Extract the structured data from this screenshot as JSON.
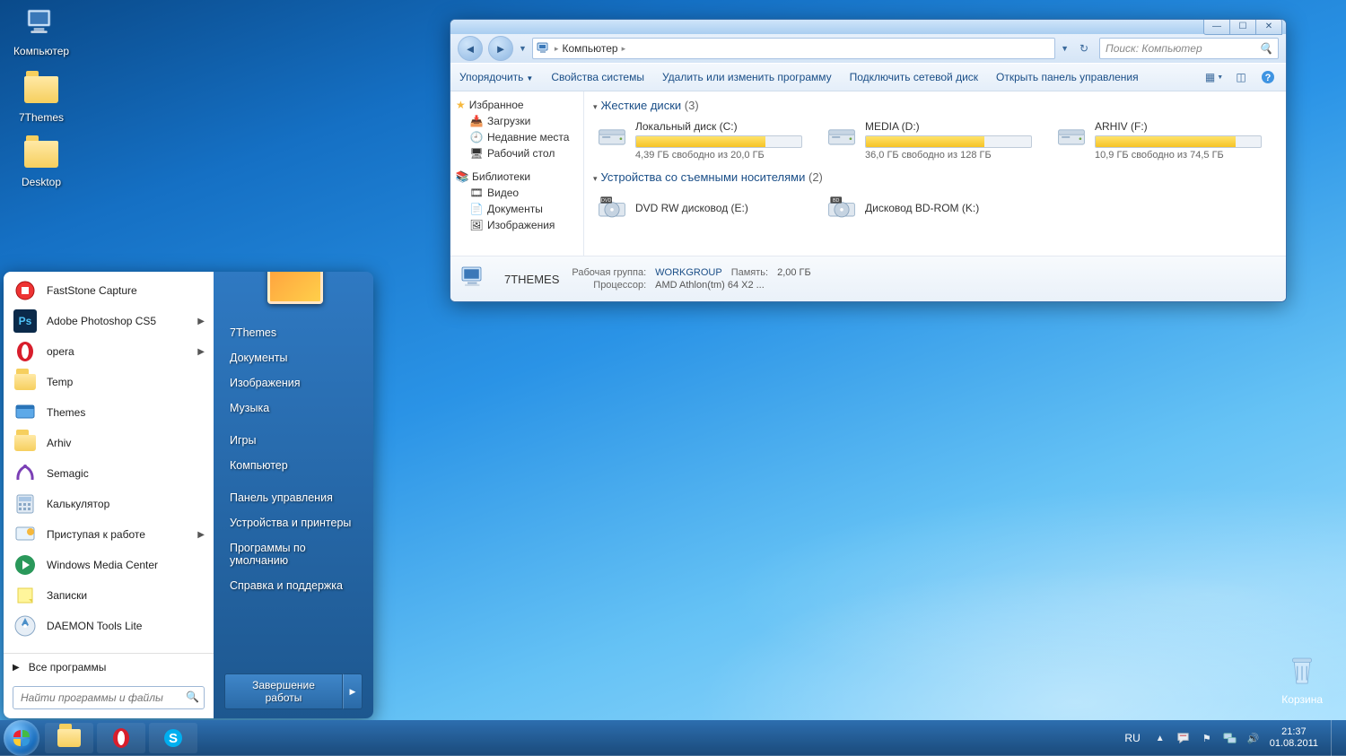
{
  "desktop": {
    "icons": [
      {
        "name": "computer",
        "label": "Компьютер"
      },
      {
        "name": "7themes",
        "label": "7Themes"
      },
      {
        "name": "desktop-folder",
        "label": "Desktop"
      }
    ],
    "recycle_label": "Корзина"
  },
  "startmenu": {
    "apps": [
      {
        "label": "FastStone Capture",
        "has_arrow": false,
        "icon_bg": "#fff",
        "icon": "fs"
      },
      {
        "label": "Adobe Photoshop CS5",
        "has_arrow": true,
        "icon_bg": "#0b2a4a",
        "icon": "ps"
      },
      {
        "label": "opera",
        "has_arrow": true,
        "icon_bg": "#fff",
        "icon": "op"
      },
      {
        "label": "Temp",
        "has_arrow": false,
        "icon_bg": "",
        "icon": "folder"
      },
      {
        "label": "Themes",
        "has_arrow": false,
        "icon_bg": "",
        "icon": "themes"
      },
      {
        "label": "Arhiv",
        "has_arrow": false,
        "icon_bg": "",
        "icon": "folder"
      },
      {
        "label": "Semagic",
        "has_arrow": false,
        "icon_bg": "#fff",
        "icon": "sem"
      },
      {
        "label": "Калькулятор",
        "has_arrow": false,
        "icon_bg": "",
        "icon": "calc"
      },
      {
        "label": "Приступая к работе",
        "has_arrow": true,
        "icon_bg": "",
        "icon": "gs"
      },
      {
        "label": "Windows Media Center",
        "has_arrow": false,
        "icon_bg": "",
        "icon": "wmc"
      },
      {
        "label": "Записки",
        "has_arrow": false,
        "icon_bg": "",
        "icon": "note"
      },
      {
        "label": "DAEMON Tools Lite",
        "has_arrow": false,
        "icon_bg": "",
        "icon": "dt"
      }
    ],
    "all_programs": "Все программы",
    "search_placeholder": "Найти программы и файлы",
    "right_links": [
      "7Themes",
      "Документы",
      "Изображения",
      "Музыка",
      "",
      "Игры",
      "Компьютер",
      "",
      "Панель управления",
      "Устройства и принтеры",
      "Программы по умолчанию",
      "Справка и поддержка"
    ],
    "shutdown": "Завершение работы"
  },
  "explorer": {
    "breadcrumb": {
      "root": "Компьютер"
    },
    "search_placeholder": "Поиск: Компьютер",
    "toolbar": {
      "organize": "Упорядочить",
      "sysprops": "Свойства системы",
      "uninstall": "Удалить или изменить программу",
      "mapdrive": "Подключить сетевой диск",
      "controlpanel": "Открыть панель управления"
    },
    "sidebar": {
      "favorites": "Избранное",
      "fav_items": [
        "Загрузки",
        "Недавние места",
        "Рабочий стол"
      ],
      "libraries": "Библиотеки",
      "lib_items": [
        "Видео",
        "Документы",
        "Изображения"
      ]
    },
    "groups": {
      "hdd": {
        "title": "Жесткие диски",
        "count": "(3)"
      },
      "removable": {
        "title": "Устройства со съемными носителями",
        "count": "(2)"
      }
    },
    "drives": [
      {
        "name": "Локальный диск (C:)",
        "free": "4,39 ГБ свободно из 20,0 ГБ",
        "fill": 78
      },
      {
        "name": "MEDIA (D:)",
        "free": "36,0 ГБ свободно из 128 ГБ",
        "fill": 72
      },
      {
        "name": "ARHIV (F:)",
        "free": "10,9 ГБ свободно из 74,5 ГБ",
        "fill": 85
      }
    ],
    "devices": [
      {
        "name": "DVD RW дисковод (E:)",
        "type": "dvd"
      },
      {
        "name": "Дисковод BD-ROM (K:)",
        "type": "bd"
      }
    ],
    "status": {
      "computer_name": "7THEMES",
      "workgroup_k": "Рабочая группа:",
      "workgroup_v": "WORKGROUP",
      "memory_k": "Память:",
      "memory_v": "2,00 ГБ",
      "cpu_k": "Процессор:",
      "cpu_v": "AMD Athlon(tm) 64 X2 ..."
    }
  },
  "taskbar": {
    "lang": "RU",
    "time": "21:37",
    "date": "01.08.2011"
  }
}
